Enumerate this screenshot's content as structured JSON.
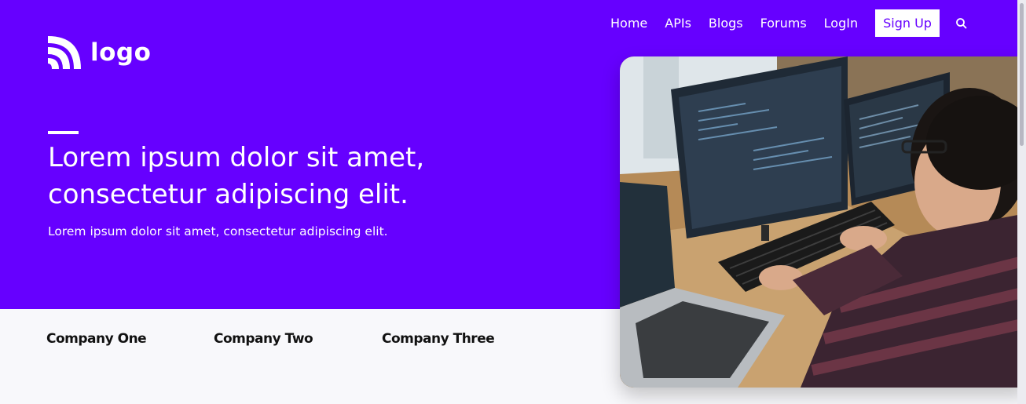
{
  "brand": {
    "logo_text": "logo"
  },
  "nav": {
    "items": [
      {
        "label": "Home"
      },
      {
        "label": "APIs"
      },
      {
        "label": "Blogs"
      },
      {
        "label": "Forums"
      },
      {
        "label": "LogIn"
      }
    ],
    "signup_label": "Sign Up",
    "search_icon": "search-icon"
  },
  "hero": {
    "headline_line1": "Lorem ipsum dolor sit amet,",
    "headline_line2": "consectetur adipiscing elit.",
    "subtitle": "Lorem ipsum dolor sit amet, consectetur adipiscing elit."
  },
  "companies": [
    {
      "name": "Company One"
    },
    {
      "name": "Company Two"
    },
    {
      "name": "Company Three"
    }
  ],
  "colors": {
    "brand": "#6600ff",
    "hero_text": "#ffffff",
    "lower_background": "#f8f8fb",
    "company_text": "#111111"
  },
  "image": {
    "subject": "developer-at-workstation-photo"
  }
}
